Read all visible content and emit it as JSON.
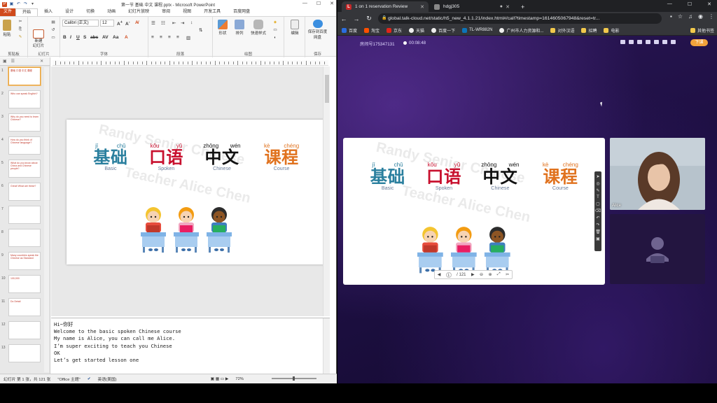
{
  "ppt": {
    "title": "第一节 基础 中文 课程.pptx - Microsoft PowerPoint",
    "tabs": [
      "文件",
      "开始",
      "插入",
      "设计",
      "切换",
      "动画",
      "幻灯片放映",
      "审阅",
      "视图",
      "开发工具",
      "百度网盘"
    ],
    "ribbon": {
      "paste": "粘贴",
      "clipboard_group": "剪贴板",
      "new_slide": "新建\n幻灯片",
      "slides_group": "幻灯片",
      "font_name": "Calibri (正文)",
      "font_size": "12",
      "font_group": "字体",
      "paragraph_group": "段落",
      "shapes": "形状",
      "arrange": "排列",
      "quick_styles": "快速样式",
      "drawing_group": "绘图",
      "edit": "编辑",
      "save_baidu": "保存到百度网盘",
      "save_group": "保存"
    },
    "thumbnails": [
      {
        "num": "1",
        "text": "基础 口语 中文 课程"
      },
      {
        "num": "2",
        "text": "Who can speak English?"
      },
      {
        "num": "3",
        "text": "Why do you need to learn Chinese?"
      },
      {
        "num": "4",
        "text": "How do you think of Chinese language?"
      },
      {
        "num": "5",
        "text": "What do you know about China and Chinese people?"
      },
      {
        "num": "6",
        "text": "Great! What are these?"
      },
      {
        "num": "7",
        "text": ""
      },
      {
        "num": "8",
        "text": ""
      },
      {
        "num": "9",
        "text": "Many countries speak the Chinese as Standard"
      },
      {
        "num": "10",
        "text": "100,000"
      },
      {
        "num": "11",
        "text": "Do Detail"
      },
      {
        "num": "12",
        "text": ""
      },
      {
        "num": "13",
        "text": ""
      }
    ],
    "notes": [
      "Hi~你好",
      "Welcome to the basic spoken Chinese course",
      "My name is Alice, you can call me Alice.",
      "I’m super exciting to teach you Chinese",
      "OK",
      "Let’s get started lesson one"
    ],
    "status": {
      "slide": "幻灯片 第 1 张，共 121 张",
      "theme": "\"Office 主题\"",
      "lang": "英语(美国)",
      "zoom": "72%"
    }
  },
  "slide": {
    "words": [
      {
        "pinyin": [
          "jī",
          "chǔ"
        ],
        "hanzi": "基础",
        "eng": "Basic",
        "color": "#2a7f9e"
      },
      {
        "pinyin": [
          "kǒu",
          "yǔ"
        ],
        "hanzi": "口语",
        "eng": "Spoken",
        "color": "#c8102e"
      },
      {
        "pinyin": [
          "zhōng",
          "wén"
        ],
        "hanzi": "中文",
        "eng": "Chinese",
        "color": "#111111"
      },
      {
        "pinyin": [
          "kè",
          "chéng"
        ],
        "hanzi": "课程",
        "eng": "Course",
        "color": "#e0721e"
      }
    ],
    "watermark1": "Randy Senior Chinese",
    "watermark2": "Teacher Alice Chen"
  },
  "browser": {
    "tabs": [
      {
        "title": "1 on 1 reservation Review",
        "active": true
      },
      {
        "title": "hdgj305",
        "active": false
      }
    ],
    "url": "global.talk-cloud.net/static/h5_new_4.1.1.21/index.html#/call?timestamp=1614605067948&reset=tr...",
    "bookmarks": [
      "百度",
      "淘宝",
      "京东",
      "天猫",
      "百度一下",
      "TL-WR882N",
      "广州市人力资源和...",
      "对外汉语",
      "招聘",
      "电影"
    ],
    "other_bookmarks": "其他书签",
    "room_id": "房间号175347131",
    "timer": "00:08:48",
    "leave_btn": "下课",
    "pager": "/ 121",
    "teacher_name": "Alice"
  }
}
